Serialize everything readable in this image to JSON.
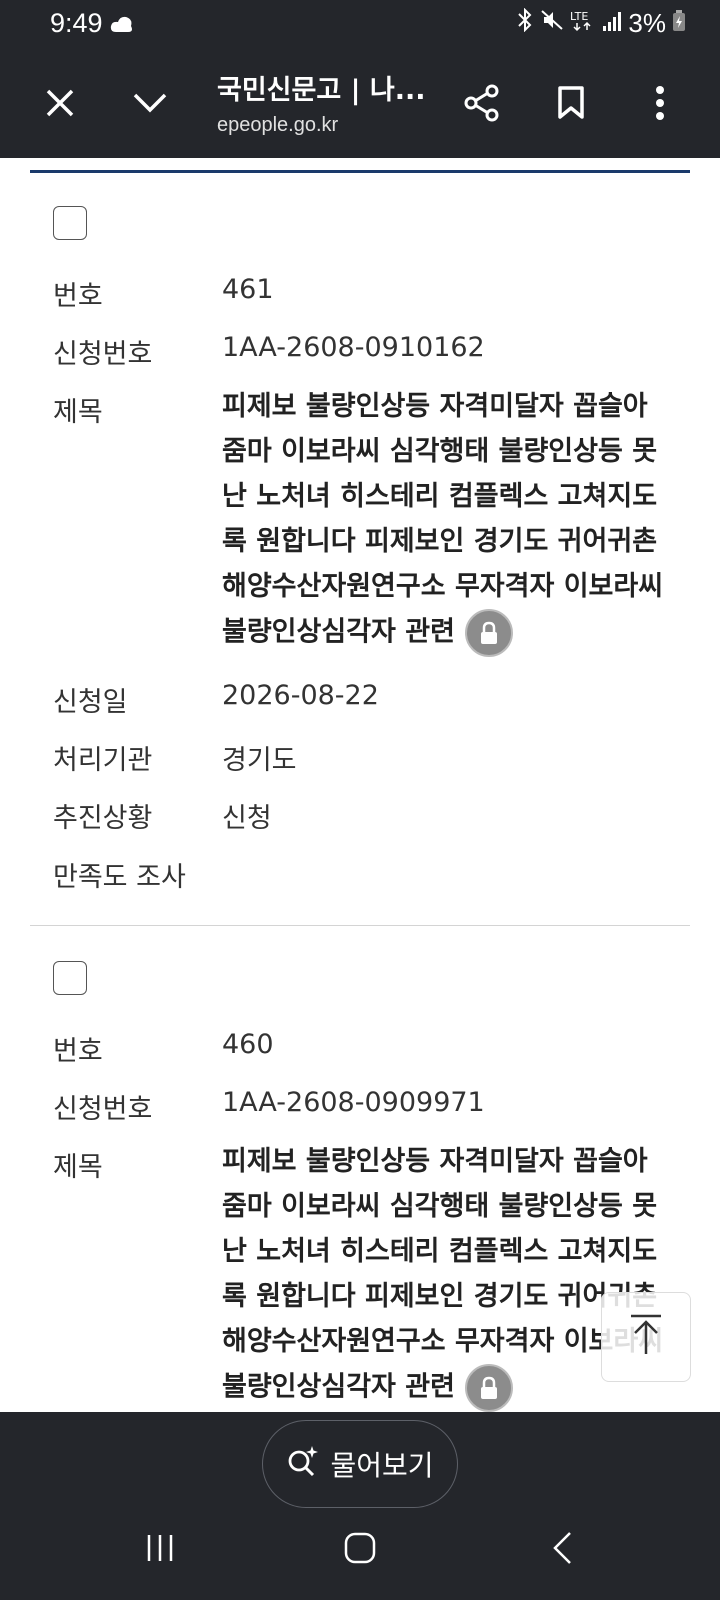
{
  "status": {
    "time": "9:49",
    "battery": "3%"
  },
  "toolbar": {
    "title": "국민신문고 | 나...",
    "url": "epeople.go.kr"
  },
  "labels": {
    "number": "번호",
    "app_number": "신청번호",
    "subject": "제목",
    "date": "신청일",
    "agency": "처리기관",
    "status": "추진상황",
    "survey": "만족도 조사"
  },
  "items": [
    {
      "number": "461",
      "app_number": "1AA-2608-0910162",
      "title": "피제보 불량인상등 자격미달자 꼽슬아줌마 이보라씨 심각행태 불량인상등 못난 노처녀 히스테리 컴플렉스 고쳐지도록 원합니다 피제보인 경기도 귀어귀촌 해양수산자원연구소 무자격자 이보라씨 불량인상심각자 관련",
      "date": "2026-08-22",
      "agency": "경기도",
      "status": "신청"
    },
    {
      "number": "460",
      "app_number": "1AA-2608-0909971",
      "title": "피제보 불량인상등 자격미달자 꼽슬아줌마 이보라씨 심각행태 불량인상등 못난 노처녀 히스테리 컴플렉스 고쳐지도록 원합니다 피제보인 경기도 귀어귀촌 해양수산자원연구소 무자격자 이보라씨 불량인상심각자 관련"
    }
  ],
  "bottom": {
    "ask_label": "물어보기"
  },
  "colors": {
    "bar_bg": "#24262b",
    "accent_line": "#1a3a6b"
  }
}
